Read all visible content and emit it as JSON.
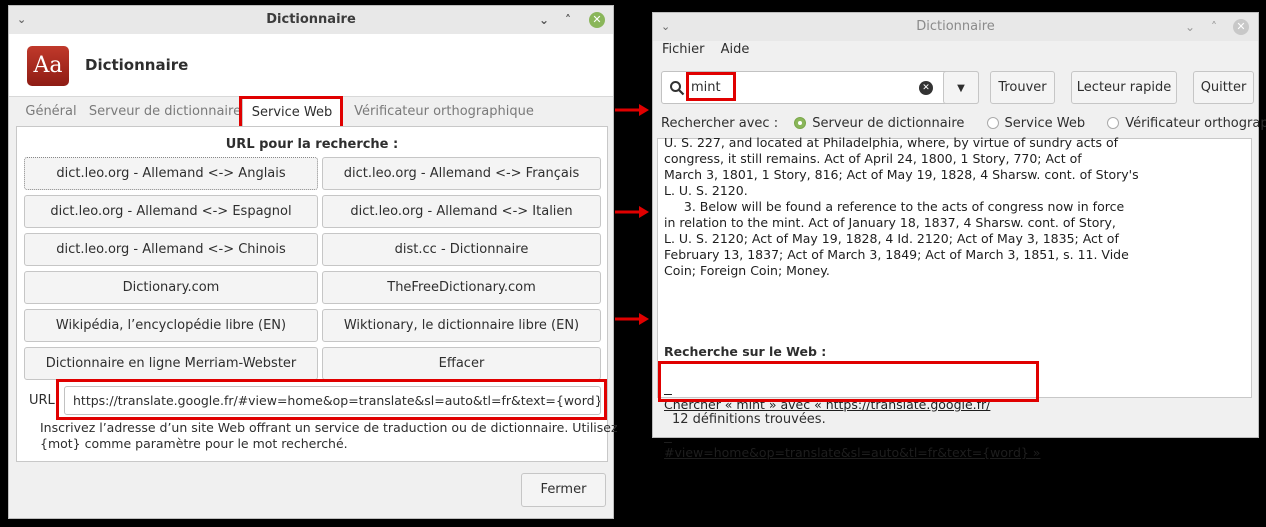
{
  "left_window": {
    "title": "Dictionnaire",
    "app_title": "Dictionnaire",
    "app_icon_text": "Aa",
    "tabs": [
      "Général",
      "Serveur de dictionnaire",
      "Service Web",
      "Vérificateur orthographique"
    ],
    "active_tab": "Service Web",
    "section_label": "URL pour la recherche :",
    "services": [
      "dict.leo.org - Allemand <-> Anglais",
      "dict.leo.org - Allemand <-> Français",
      "dict.leo.org - Allemand <-> Espagnol",
      "dict.leo.org - Allemand <-> Italien",
      "dict.leo.org - Allemand <-> Chinois",
      "dist.cc - Dictionnaire",
      "Dictionary.com",
      "TheFreeDictionary.com",
      "Wikipédia, l’encyclopédie libre (EN)",
      "Wiktionary, le dictionnaire libre (EN)",
      "Dictionnaire en ligne Merriam-Webster",
      "Effacer"
    ],
    "url_label": "URL",
    "url_value": "https://translate.google.fr/#view=home&op=translate&sl=auto&tl=fr&text={word}",
    "help_line1": "Inscrivez l’adresse d’un site Web offrant un service de traduction ou de dictionnaire. Utilisez",
    "help_line2": "{mot} comme paramètre pour le mot recherché.",
    "close_label": "Fermer"
  },
  "right_window": {
    "title": "Dictionnaire",
    "menu": [
      "Fichier",
      "Aide"
    ],
    "search_value": "mint",
    "buttons": {
      "find": "Trouver",
      "quick": "Lecteur rapide",
      "quit": "Quitter"
    },
    "search_with_label": "Rechercher avec :",
    "radios": [
      "Serveur de dictionnaire",
      "Service Web",
      "Vérificateur orthographique"
    ],
    "selected_radio": "Serveur de dictionnaire",
    "definition_lines": [
      "U. S. 227, and located at Philadelphia, where, by virtue of sundry acts of",
      "congress, it still remains. Act of April 24, 1800, 1 Story, 770; Act of",
      "March 3, 1801, 1 Story, 816; Act of May 19, 1828, 4 Sharsw. cont. of Story's",
      "L. U. S. 2120.",
      "     3. Below will be found a reference to the acts of congress now in force",
      "in relation to the mint. Act of January 18, 1837, 4 Sharsw. cont. of Story,",
      "L. U. S. 2120; Act of May 19, 1828, 4 Id. 2120; Act of May 3, 1835; Act of",
      "February 13, 1837; Act of March 3, 1849; Act of March 3, 1851, s. 11. Vide",
      "Coin; Foreign Coin; Money."
    ],
    "web_heading": "Recherche sur le Web :",
    "web_link_line1": "Chercher « mint » avec « https://translate.google.fr/",
    "web_link_line2": "#view=home&op=translate&sl=auto&tl=fr&text={word} »",
    "status": "12 définitions trouvées."
  },
  "colors": {
    "highlight": "#e00000",
    "accent": "#8ab65a"
  }
}
